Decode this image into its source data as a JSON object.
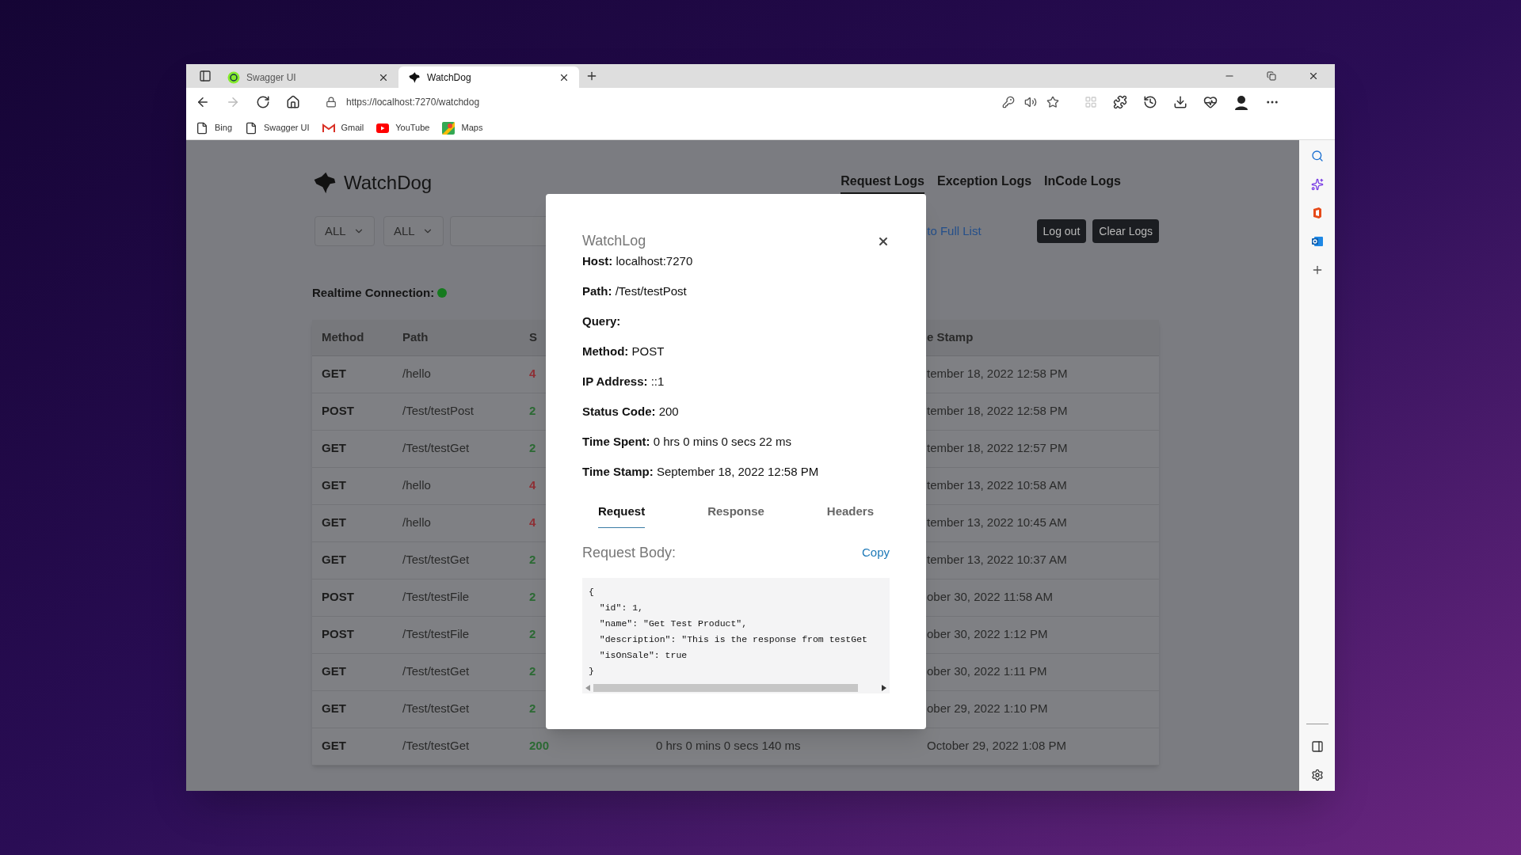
{
  "browser": {
    "tabs": [
      {
        "title": "Swagger UI",
        "selected": false
      },
      {
        "title": "WatchDog",
        "selected": true
      }
    ],
    "url": "https://localhost:7270/watchdog",
    "bookmarks": [
      {
        "label": "Bing"
      },
      {
        "label": "Swagger UI"
      },
      {
        "label": "Gmail"
      },
      {
        "label": "YouTube"
      },
      {
        "label": "Maps"
      }
    ]
  },
  "app": {
    "brand": "WatchDog",
    "nav": [
      {
        "label": "Request Logs",
        "selected": true
      },
      {
        "label": "Exception Logs",
        "selected": false
      },
      {
        "label": "InCode Logs",
        "selected": false
      }
    ],
    "filters": [
      {
        "value": "ALL"
      },
      {
        "value": "ALL"
      }
    ],
    "back_link": "to Full List",
    "buttons": [
      "Log out",
      "Clear Logs"
    ],
    "realtime_label": "Realtime Connection:",
    "realtime_connected": true,
    "table": {
      "columns": [
        "Method",
        "Path",
        "S",
        "e Stamp"
      ],
      "rows": [
        {
          "method": "GET",
          "path": "/hello",
          "status": "4",
          "color": "#8f2f35",
          "time_stamp": "tember 18, 2022 12:58 PM"
        },
        {
          "method": "POST",
          "path": "/Test/testPost",
          "status": "2",
          "color": "#2c6a34",
          "time_stamp": "tember 18, 2022 12:58 PM"
        },
        {
          "method": "GET",
          "path": "/Test/testGet",
          "status": "2",
          "color": "#2c6a34",
          "time_stamp": "tember 18, 2022 12:57 PM"
        },
        {
          "method": "GET",
          "path": "/hello",
          "status": "4",
          "color": "#8f2f35",
          "time_stamp": "tember 13, 2022 10:58 AM"
        },
        {
          "method": "GET",
          "path": "/hello",
          "status": "4",
          "color": "#8f2f35",
          "time_stamp": "tember 13, 2022 10:45 AM"
        },
        {
          "method": "GET",
          "path": "/Test/testGet",
          "status": "2",
          "color": "#2c6a34",
          "time_stamp": "tember 13, 2022 10:37 AM"
        },
        {
          "method": "POST",
          "path": "/Test/testFile",
          "status": "2",
          "color": "#2c6a34",
          "time_stamp": "ober 30, 2022 11:58 AM"
        },
        {
          "method": "POST",
          "path": "/Test/testFile",
          "status": "2",
          "color": "#2c6a34",
          "time_stamp": "ober 30, 2022 1:12 PM"
        },
        {
          "method": "GET",
          "path": "/Test/testGet",
          "status": "2",
          "color": "#2c6a34",
          "time_stamp": "ober 30, 2022 1:11 PM"
        },
        {
          "method": "GET",
          "path": "/Test/testGet",
          "status": "2",
          "color": "#2c6a34",
          "time_stamp": "ober 29, 2022 1:10 PM"
        },
        {
          "method": "GET",
          "path": "/Test/testGet",
          "status": "200",
          "color": "#2c6a34",
          "time_spent": "0 hrs 0 mins 0 secs 140 ms",
          "time_stamp": "October 29, 2022 1:08 PM"
        }
      ]
    }
  },
  "modal": {
    "title": "WatchLog",
    "fields": [
      {
        "label": "Host:",
        "value": "localhost:7270"
      },
      {
        "label": "Path:",
        "value": "/Test/testPost"
      },
      {
        "label": "Query:"
      },
      {
        "label": "Method:",
        "value": "POST"
      },
      {
        "label": "IP Address:",
        "value": "::1"
      },
      {
        "label": "Status Code:",
        "value": "200"
      },
      {
        "label": "Time Spent:",
        "value": "0 hrs 0 mins 0 secs 22 ms"
      },
      {
        "label": "Time Stamp:",
        "value": "September 18, 2022 12:58 PM"
      }
    ],
    "tabs": [
      {
        "label": "Request",
        "selected": true
      },
      {
        "label": "Response",
        "selected": false
      },
      {
        "label": "Headers",
        "selected": false
      }
    ],
    "body_label": "Request Body:",
    "copy": "Copy",
    "code": [
      "{",
      "  \"id\": 1,",
      "  \"name\": \"Get Test Product\",",
      "  \"description\": \"This is the response from testGet",
      "  \"isOnSale\": true",
      "}"
    ]
  }
}
